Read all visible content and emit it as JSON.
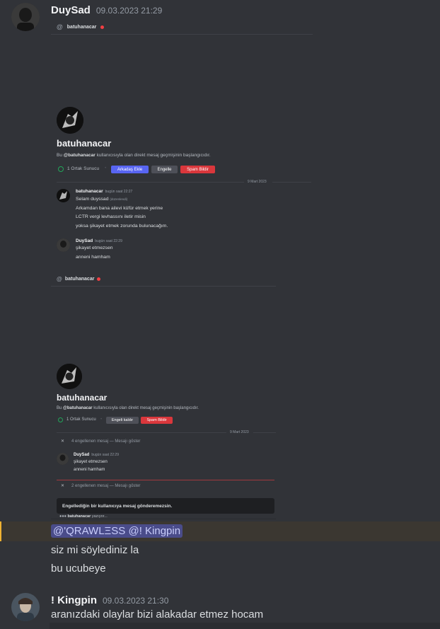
{
  "message1": {
    "username": "DuySad",
    "timestamp": "09.03.2023 21:29",
    "embed": {
      "shot1": {
        "topbar_name": "batuhanacar",
        "profile_name": "batuhanacar",
        "intro_prefix": "Bu ",
        "intro_handle": "@batuhanacar",
        "intro_rest": " kullanıcısıyla olan direkt mesaj geçmişinin başlangıcıdır.",
        "mutual_servers": "1 Ortak Sunucu",
        "buttons": [
          "Arkadaş Ekle",
          "Engelle",
          "Spam Bildir"
        ],
        "date_divider": "9 Mart 2023",
        "messages": [
          {
            "author": "batuhanacar",
            "time": "bugün saat 22:27",
            "lines": [
              "Selam duyssad",
              "Arkamdan bana ailevi küfür etmek yerine",
              "LCTR vergi levhassını iletir misin",
              "yoksa şikayet etmek zorunda bulunacağım."
            ],
            "edited": "(düzenlendi)"
          },
          {
            "author": "DuySad",
            "time": "bugün saat 22:29",
            "lines": [
              "şikayet etmezsen",
              "anneni hamham"
            ]
          }
        ]
      },
      "shot2": {
        "topbar_name": "batuhanacar",
        "profile_name": "batuhanacar",
        "intro_prefix": "Bu ",
        "intro_handle": "@batuhanacar",
        "intro_rest": " kullanıcısıyla olan direkt mesaj geçmişinin başlangıcıdır.",
        "mutual_servers": "1 Ortak Sunucu",
        "buttons": [
          "Engeli kaldır",
          "Spam Bildir"
        ],
        "date_divider": "9 Mart 2023",
        "blocked1": "4 engellenen mesaj — Mesajı göster",
        "message": {
          "author": "DuySad",
          "time": "bugün saat 22:29",
          "lines": [
            "şikayet etmezsen",
            "anneni hamham"
          ]
        },
        "blocked2": "2 engellenen mesaj — Mesajı göster",
        "blocked_notice": "Engellediğin bir kullanıcıya mesaj gönderemezsin.",
        "typing_user": "batuhanacar",
        "typing_text": " yazıyor..."
      }
    },
    "mention_text": "@'QRAWLΞSS @! Kingpin",
    "lines": [
      "siz mi söylediniz la",
      "bu ucubeye"
    ]
  },
  "message2": {
    "username": "! Kingpin",
    "timestamp": "09.03.2023 21:30",
    "text": "aranızdaki olaylar bizi alakadar etmez hocam"
  },
  "colors": {
    "background": "#313338",
    "mention_highlight": "#f0b232",
    "blurple": "#5865f2",
    "danger": "#da373c"
  },
  "icons": [
    "at-icon",
    "status-dnd-icon",
    "server-icon",
    "close-icon",
    "typing-dots-icon"
  ]
}
